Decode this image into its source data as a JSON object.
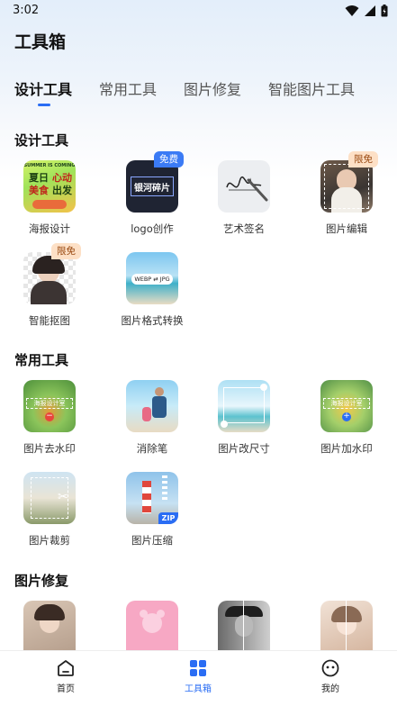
{
  "status": {
    "time": "3:02"
  },
  "title": "工具箱",
  "tabs": [
    "设计工具",
    "常用工具",
    "图片修复",
    "智能图片工具"
  ],
  "sections": {
    "design": {
      "title": "设计工具",
      "items": [
        {
          "label": "海报设计",
          "poster_text1": "SUMMER IS COMING",
          "poster_text2": "夏日",
          "poster_text3": "心动",
          "poster_text4": "美食",
          "poster_text5": "出发"
        },
        {
          "label": "logo创作",
          "badge": "免费",
          "logo_text": "银河碎片"
        },
        {
          "label": "艺术签名"
        },
        {
          "label": "图片编辑",
          "badge": "限免"
        },
        {
          "label": "智能抠图",
          "badge": "限免"
        },
        {
          "label": "图片格式转换",
          "format_text": "WEBP ⇄ JPG"
        }
      ]
    },
    "common": {
      "title": "常用工具",
      "items": [
        {
          "label": "图片去水印",
          "wm_text": "海报设计室"
        },
        {
          "label": "消除笔"
        },
        {
          "label": "图片改尺寸"
        },
        {
          "label": "图片加水印",
          "wm_text": "海报设计室"
        },
        {
          "label": "图片裁剪"
        },
        {
          "label": "图片压缩",
          "zip_text": "ZIP"
        }
      ]
    },
    "repair": {
      "title": "图片修复"
    }
  },
  "nav": {
    "home": "首页",
    "toolbox": "工具箱",
    "mine": "我的",
    "active_color": "#2a6df4"
  }
}
